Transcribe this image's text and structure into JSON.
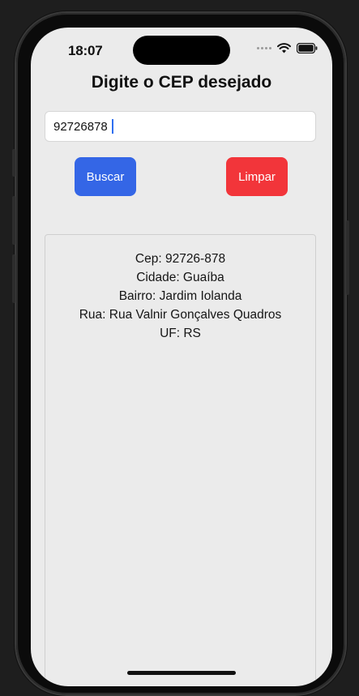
{
  "status_bar": {
    "time": "18:07"
  },
  "page": {
    "title": "Digite o CEP desejado"
  },
  "cep_input": {
    "value": "92726878"
  },
  "buttons": {
    "search_label": "Buscar",
    "clear_label": "Limpar"
  },
  "result": {
    "cep": "Cep: 92726-878",
    "cidade": "Cidade: Guaíba",
    "bairro": "Bairro: Jardim Iolanda",
    "rua": "Rua: Rua Valnir Gonçalves Quadros",
    "uf": "UF: RS"
  },
  "colors": {
    "search_button": "#3466e6",
    "clear_button": "#f2353a",
    "screen_background": "#ebebeb"
  },
  "icons": {
    "signal": "signal-dots-icon",
    "wifi": "wifi-icon",
    "battery": "battery-icon"
  }
}
